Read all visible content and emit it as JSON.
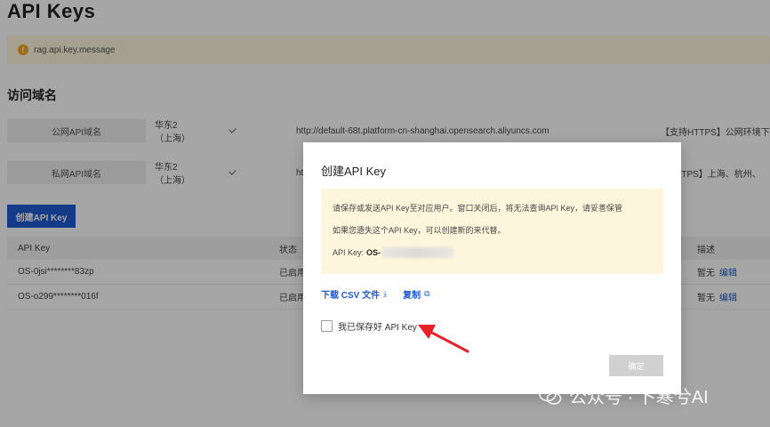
{
  "page": {
    "title": "API Keys",
    "alert_text": "rag.api.key.message",
    "section_title": "访问域名"
  },
  "domains": [
    {
      "label": "公网API域名",
      "region": "华东2（上海）",
      "url": "http://default-68t.platform-cn-shanghai.opensearch.aliyuncs.com",
      "note": "【支持HTTPS】公网环境下使"
    },
    {
      "label": "私网API域名",
      "region": "华东2（上海）",
      "url": "ht",
      "note": "持HTTPS】上海、杭州、"
    }
  ],
  "create_button": "创建API Key",
  "table": {
    "headers": {
      "key": "API Key",
      "status": "状态",
      "desc": "描述"
    },
    "rows": [
      {
        "key": "OS-0jsi********83zp",
        "status": "已启用",
        "desc": "暂无",
        "action": "编辑"
      },
      {
        "key": "OS-o299********016f",
        "status": "已启用",
        "desc": "暂无",
        "action": "编辑"
      }
    ]
  },
  "modal": {
    "title": "创建API Key",
    "notice_line1": "请保存或发送API Key至对应用户。窗口关闭后，将无法查询API Key，请妥善保管",
    "notice_line2": "如果您遗失这个API Key，可以创建新的来代替。",
    "key_label": "API Key:",
    "key_prefix": "OS-",
    "download_csv": "下载 CSV 文件",
    "copy": "复制",
    "checkbox_label": "我已保存好 API Key",
    "confirm": "确定"
  },
  "watermark": "公众号 · 卜寒兮AI",
  "colors": {
    "primary": "#1f5bd1",
    "alert_bg": "#fdf6dc",
    "arrow": "#e8202a"
  }
}
